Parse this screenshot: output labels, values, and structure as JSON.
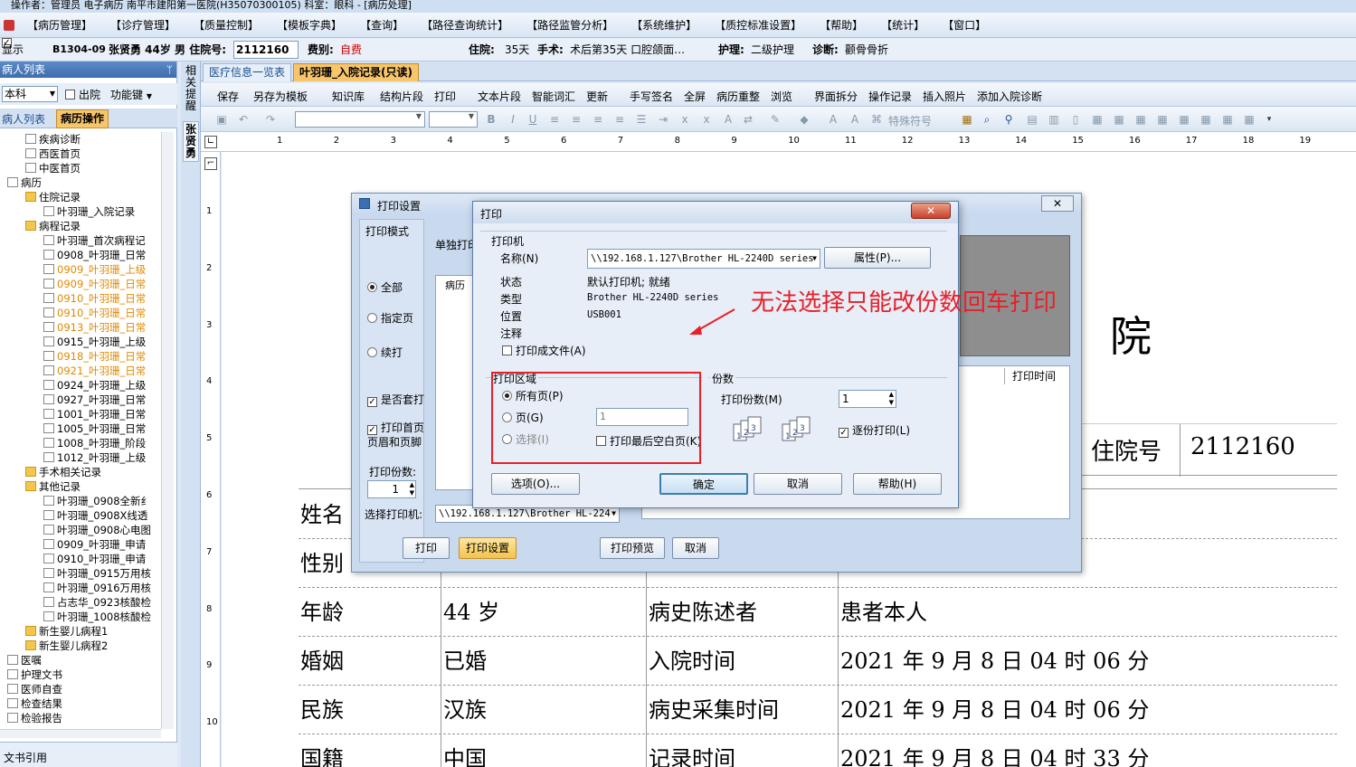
{
  "title": "操作者：管理员 电子病历  南平市建阳第一医院(H35070300105)  科室：眼科 - [病历处理]",
  "menu": [
    "【病历管理】",
    "【诊疗管理】",
    "【质量控制】",
    "【模板字典】",
    "【查询】",
    "【路径查询统计】",
    "【路径监管分析】",
    "【系统维护】",
    "【质控标准设置】",
    "【帮助】",
    "【统计】",
    "【窗口】"
  ],
  "patient": {
    "show_label": "显示",
    "bed": "B1304-09",
    "name_info": "张贤勇 44岁 男 住院号:",
    "inpatient_no": "2112160",
    "fee_type_label": "费别:",
    "fee_type": "自费",
    "hospital_days_label": "住院:",
    "hospital_days": "35天",
    "surgery_label": "手术:",
    "surgery": "术后第35天 口腔颌面…",
    "nursing_label": "护理:",
    "nursing": "二级护理",
    "diagnosis_label": "诊断:",
    "diagnosis": "颧骨骨折"
  },
  "left_panel": {
    "header": "病人列表",
    "dept": "本科",
    "discharged": "出院",
    "function_key": "功能键",
    "tab_list": "病人列表",
    "tab_ops": "病历操作",
    "bottom": "文书引用"
  },
  "tree": [
    {
      "label": "疾病诊断",
      "color": "black"
    },
    {
      "label": "西医首页",
      "color": "black"
    },
    {
      "label": "中医首页",
      "color": "black"
    },
    {
      "label": "病历",
      "color": "black"
    },
    {
      "label": "住院记录",
      "color": "black"
    },
    {
      "label": "叶羽珊_入院记录",
      "color": "black"
    },
    {
      "label": "病程记录",
      "color": "black"
    },
    {
      "label": "叶羽珊_首次病程记",
      "color": "black"
    },
    {
      "label": "0908_叶羽珊_日常",
      "color": "black"
    },
    {
      "label": "0909_叶羽珊_上级",
      "color": "orange"
    },
    {
      "label": "0909_叶羽珊_日常",
      "color": "orange"
    },
    {
      "label": "0910_叶羽珊_日常",
      "color": "orange"
    },
    {
      "label": "0910_叶羽珊_日常",
      "color": "orange"
    },
    {
      "label": "0913_叶羽珊_日常",
      "color": "orange"
    },
    {
      "label": "0915_叶羽珊_上级",
      "color": "black"
    },
    {
      "label": "0918_叶羽珊_日常",
      "color": "orange"
    },
    {
      "label": "0921_叶羽珊_日常",
      "color": "orange"
    },
    {
      "label": "0924_叶羽珊_上级",
      "color": "black"
    },
    {
      "label": "0927_叶羽珊_日常",
      "color": "black"
    },
    {
      "label": "1001_叶羽珊_日常",
      "color": "black"
    },
    {
      "label": "1005_叶羽珊_日常",
      "color": "black"
    },
    {
      "label": "1008_叶羽珊_阶段",
      "color": "black"
    },
    {
      "label": "1012_叶羽珊_上级",
      "color": "black"
    },
    {
      "label": "手术相关记录",
      "color": "black"
    },
    {
      "label": "其他记录",
      "color": "black"
    },
    {
      "label": "叶羽珊_0908全新纟",
      "color": "black"
    },
    {
      "label": "叶羽珊_0908X线透",
      "color": "black"
    },
    {
      "label": "叶羽珊_0908心电图",
      "color": "black"
    },
    {
      "label": "0909_叶羽珊_申请",
      "color": "black"
    },
    {
      "label": "0910_叶羽珊_申请",
      "color": "black"
    },
    {
      "label": "叶羽珊_0915万用核",
      "color": "black"
    },
    {
      "label": "叶羽珊_0916万用核",
      "color": "black"
    },
    {
      "label": "占志华_0923核酸检",
      "color": "black"
    },
    {
      "label": "叶羽珊_1008核酸检",
      "color": "black"
    },
    {
      "label": "新生婴儿病程1",
      "color": "black"
    },
    {
      "label": "新生婴儿病程2",
      "color": "black"
    },
    {
      "label": "医嘱",
      "color": "black"
    },
    {
      "label": "护理文书",
      "color": "black"
    },
    {
      "label": "医师自查",
      "color": "black"
    },
    {
      "label": "检查结果",
      "color": "black"
    },
    {
      "label": "检验报告",
      "color": "black"
    }
  ],
  "vtabs": {
    "hint": "相关提醒",
    "patient": "张贤勇"
  },
  "doc_tabs": {
    "overview": "医疗信息一览表",
    "current": "叶羽珊_入院记录(只读)"
  },
  "toolbar": [
    "保存",
    "另存为模板",
    "知识库",
    "结构片段",
    "打印",
    "文本片段",
    "智能词汇",
    "更新",
    "手写签名",
    "全屏",
    "病历重整",
    "浏览",
    "界面拆分",
    "操作记录",
    "插入照片",
    "添加入院诊断"
  ],
  "toolbar2": {
    "special_chars": "特殊符号"
  },
  "ruler": [
    "1",
    "2",
    "3",
    "4",
    "5",
    "6",
    "7",
    "8",
    "9",
    "10",
    "11",
    "12",
    "13",
    "14",
    "15",
    "16",
    "17",
    "18",
    "19",
    "2"
  ],
  "vruler": [
    "1",
    "2",
    "3",
    "4",
    "5",
    "6",
    "7",
    "8",
    "9",
    "10"
  ],
  "document": {
    "hospital_char": "院",
    "inpatient_label": "住院号",
    "inpatient_value": "2112160",
    "rows": [
      {
        "c1": "姓名",
        "c2": "",
        "c3": "",
        "c4": ""
      },
      {
        "c1": "性别",
        "c2": "",
        "c3": "",
        "c4": ""
      },
      {
        "c1": "年龄",
        "c2": "44 岁",
        "c3": "病史陈述者",
        "c4": "患者本人"
      },
      {
        "c1": "婚姻",
        "c2": "已婚",
        "c3": "入院时间",
        "c4": "2021 年 9 月 8 日 04 时 06 分"
      },
      {
        "c1": "民族",
        "c2": "汉族",
        "c3": "病史采集时间",
        "c4": "2021 年 9 月 8 日 04 时 06 分"
      },
      {
        "c1": "国籍",
        "c2": "中国",
        "c3": "记录时间",
        "c4": "2021 年 9 月 8 日 04 时 33 分"
      }
    ]
  },
  "print_settings": {
    "title": "打印设置",
    "mode_label": "打印模式",
    "single_label": "单独打印",
    "all": "全部",
    "specified": "指定页",
    "continue": "续打",
    "overlay": "是否套打",
    "header_footer": "打印首页页眉和页脚",
    "copies_label": "打印份数:",
    "copies": "1",
    "tree_item": "病历",
    "select_printer_label": "选择打印机:",
    "printer": "\\\\192.168.1.127\\Brother HL-224",
    "col_print_time": "打印时间",
    "btn_print": "打印",
    "btn_settings": "打印设置",
    "btn_preview": "打印预览",
    "btn_cancel": "取消"
  },
  "print_dialog": {
    "title": "打印",
    "printer_group": "打印机",
    "name_label": "名称(N)",
    "name_value": "\\\\192.168.1.127\\Brother HL-2240D series",
    "properties": "属性(P)...",
    "status_label": "状态",
    "status_value": "默认打印机; 就绪",
    "type_label": "类型",
    "type_value": "Brother HL-2240D series",
    "where_label": "位置",
    "where_value": "USB001",
    "comment_label": "注释",
    "print_to_file": "打印成文件(A)",
    "range_group": "打印区域",
    "all_pages": "所有页(P)",
    "pages": "页(G)",
    "pages_value": "1",
    "selection": "选择(I)",
    "last_blank": "打印最后空白页(K)",
    "copies_group": "份数",
    "copies_label": "打印份数(M)",
    "copies_value": "1",
    "collate": "逐份打印(L)",
    "options": "选项(O)...",
    "ok": "确定",
    "cancel": "取消",
    "help": "帮助(H)"
  },
  "annotation": "无法选择只能改份数回车打印",
  "colors": {
    "annotation": "#e8202a",
    "accent": "#3e6cae",
    "orange_item": "#e08a00",
    "fee_red": "#d00000"
  }
}
